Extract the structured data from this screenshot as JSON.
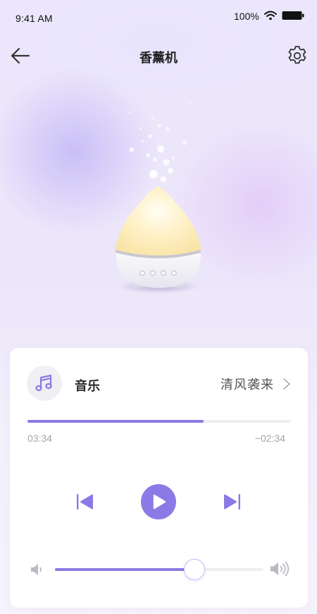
{
  "status_bar": {
    "time": "9:41 AM",
    "battery": "100%"
  },
  "header": {
    "title": "香薰机",
    "back_icon": "arrow-left-icon",
    "settings_icon": "gear-icon"
  },
  "player": {
    "icon": "music-note-icon",
    "label": "音乐",
    "track": "清风袭来",
    "elapsed": "03:34",
    "remaining": "−02:34",
    "progress": 0.67,
    "volume": 0.67
  },
  "colors": {
    "accent": "#8b7ae6",
    "track_bg": "#eeeef2",
    "background": "#ece6fa"
  }
}
